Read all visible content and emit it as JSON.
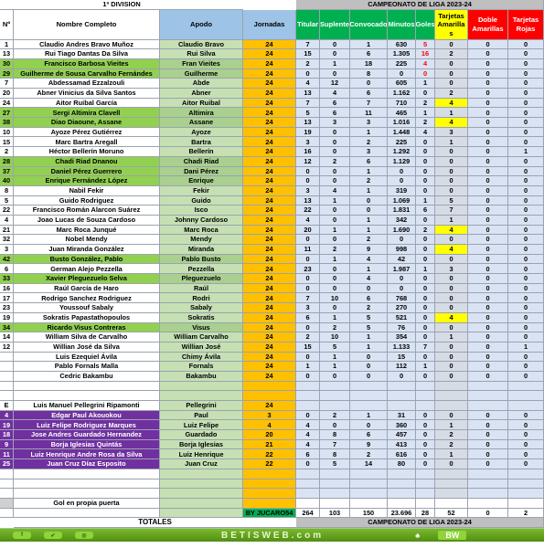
{
  "title": "1ª DIVISION",
  "competition": "CAMPEONATO  DE LIGA 2023-24",
  "headers": {
    "num": "Nº",
    "name": "Nombre Completo",
    "apodo": "Apodo",
    "jornadas": "Jornadas",
    "titular": "Titular",
    "suplente": "Suplente",
    "convocado": "Convocado",
    "minutos": "Minutos",
    "goles": "Goles",
    "amarillas": "Tarjetas Amarilla s",
    "doble": "Doble Amarillas",
    "rojas": "Tarjetas Rojas"
  },
  "colors": {
    "green": "#92d050",
    "purple": "#7030a0",
    "apodo": "#c6e0b4",
    "jornadas": "#ffc000",
    "stats": "#dae3f3",
    "yellow": "#ffff00",
    "red": "#ff0000",
    "stats_header": "#00b050"
  },
  "players": [
    {
      "num": "1",
      "name": "Claudio Andres Bravo Muñoz",
      "apodo": "Claudio Bravo",
      "jornadas": "24",
      "stats": [
        "7",
        "0",
        "1",
        "630",
        "5",
        "0",
        "0",
        "0"
      ],
      "goles_red": true
    },
    {
      "num": "13",
      "name": "Rui Tiago Dantas Da Silva",
      "apodo": "Rui Silva",
      "jornadas": "24",
      "stats": [
        "15",
        "0",
        "6",
        "1.305",
        "16",
        "2",
        "0",
        "0"
      ],
      "goles_red": true
    },
    {
      "num": "30",
      "name": "Francisco Barbosa Vieites",
      "apodo": "Fran Vieites",
      "jornadas": "24",
      "stats": [
        "2",
        "1",
        "18",
        "225",
        "4",
        "0",
        "0",
        "0"
      ],
      "goles_red": true,
      "style": "green"
    },
    {
      "num": "29",
      "name": "Guilherme de Sousa Carvalho Fernándes",
      "apodo": "Guilherme",
      "jornadas": "24",
      "stats": [
        "0",
        "0",
        "8",
        "0",
        "0",
        "0",
        "0",
        "0"
      ],
      "goles_red": true,
      "style": "green"
    },
    {
      "num": "7",
      "name": "Abdessamad Ezzalzouli",
      "apodo": "Abde",
      "jornadas": "24",
      "stats": [
        "4",
        "12",
        "0",
        "605",
        "1",
        "0",
        "0",
        "0"
      ]
    },
    {
      "num": "20",
      "name": "Abner Vinicius da Silva Santos",
      "apodo": "Abner",
      "jornadas": "24",
      "stats": [
        "13",
        "4",
        "6",
        "1.162",
        "0",
        "2",
        "0",
        "0"
      ]
    },
    {
      "num": "24",
      "name": "Aitor Ruibal García",
      "apodo": "Aitor Ruibal",
      "jornadas": "24",
      "stats": [
        "7",
        "6",
        "7",
        "710",
        "2",
        "4",
        "0",
        "0"
      ],
      "ama_yellow": true
    },
    {
      "num": "27",
      "name": "Sergi Altimira Clavell",
      "apodo": "Altimira",
      "jornadas": "24",
      "stats": [
        "5",
        "6",
        "11",
        "465",
        "1",
        "1",
        "0",
        "0"
      ],
      "style": "green"
    },
    {
      "num": "38",
      "name": "Diao Diaoune, Assane",
      "apodo": "Assane",
      "jornadas": "24",
      "stats": [
        "13",
        "3",
        "3",
        "1.016",
        "2",
        "4",
        "0",
        "0"
      ],
      "style": "green",
      "ama_yellow": true
    },
    {
      "num": "10",
      "name": "Ayoze Pérez Gutiérrez",
      "apodo": "Ayoze",
      "jornadas": "24",
      "stats": [
        "19",
        "0",
        "1",
        "1.448",
        "4",
        "3",
        "0",
        "0"
      ]
    },
    {
      "num": "15",
      "name": "Marc Bartra Aregall",
      "apodo": "Bartra",
      "jornadas": "24",
      "stats": [
        "3",
        "0",
        "2",
        "225",
        "0",
        "1",
        "0",
        "0"
      ]
    },
    {
      "num": "2",
      "name": "Héctor Bellerín Moruno",
      "apodo": "Bellerín",
      "jornadas": "24",
      "stats": [
        "16",
        "0",
        "3",
        "1.292",
        "0",
        "0",
        "0",
        "1"
      ]
    },
    {
      "num": "28",
      "name": "Chadi Riad Dnanou",
      "apodo": "Chadi Riad",
      "jornadas": "24",
      "stats": [
        "12",
        "2",
        "6",
        "1.129",
        "0",
        "0",
        "0",
        "0"
      ],
      "style": "green"
    },
    {
      "num": "37",
      "name": "Daniel Pérez Guerrero",
      "apodo": "Dani Pérez",
      "jornadas": "24",
      "stats": [
        "0",
        "0",
        "1",
        "0",
        "0",
        "0",
        "0",
        "0"
      ],
      "style": "green"
    },
    {
      "num": "40",
      "name": "Enrique Fernández López",
      "apodo": "Enrique",
      "jornadas": "24",
      "stats": [
        "0",
        "0",
        "2",
        "0",
        "0",
        "0",
        "0",
        "0"
      ],
      "style": "green"
    },
    {
      "num": "8",
      "name": "Nabil Fekir",
      "apodo": "Fekir",
      "jornadas": "24",
      "stats": [
        "3",
        "4",
        "1",
        "319",
        "0",
        "0",
        "0",
        "0"
      ]
    },
    {
      "num": "5",
      "name": "Guido Rodriguez",
      "apodo": "Guido",
      "jornadas": "24",
      "stats": [
        "13",
        "1",
        "0",
        "1.069",
        "1",
        "5",
        "0",
        "0"
      ]
    },
    {
      "num": "22",
      "name": "Francisco Román Alarcon Suárez",
      "apodo": "Isco",
      "jornadas": "24",
      "stats": [
        "22",
        "0",
        "0",
        "1.831",
        "6",
        "7",
        "0",
        "0"
      ]
    },
    {
      "num": "4",
      "name": "Joao Lucas de Souza Cardoso",
      "apodo": "Johnny Cardoso",
      "jornadas": "24",
      "stats": [
        "4",
        "0",
        "1",
        "342",
        "0",
        "1",
        "0",
        "0"
      ]
    },
    {
      "num": "21",
      "name": "Marc Roca Junqué",
      "apodo": "Marc Roca",
      "jornadas": "24",
      "stats": [
        "20",
        "1",
        "1",
        "1.690",
        "2",
        "4",
        "0",
        "0"
      ],
      "ama_yellow": true
    },
    {
      "num": "32",
      "name": "Nobel Mendy",
      "apodo": "Mendy",
      "jornadas": "24",
      "stats": [
        "0",
        "0",
        "2",
        "0",
        "0",
        "0",
        "0",
        "0"
      ]
    },
    {
      "num": "3",
      "name": "Juan Miranda González",
      "apodo": "Miranda",
      "jornadas": "24",
      "stats": [
        "11",
        "2",
        "9",
        "998",
        "0",
        "4",
        "0",
        "0"
      ],
      "ama_yellow": true
    },
    {
      "num": "42",
      "name": "Busto González, Pablo",
      "apodo": "Pablo Busto",
      "jornadas": "24",
      "stats": [
        "0",
        "1",
        "4",
        "42",
        "0",
        "0",
        "0",
        "0"
      ],
      "style": "green"
    },
    {
      "num": "6",
      "name": "German Alejo Pezzella",
      "apodo": "Pezzella",
      "jornadas": "24",
      "stats": [
        "23",
        "0",
        "1",
        "1.987",
        "1",
        "3",
        "0",
        "0"
      ]
    },
    {
      "num": "33",
      "name": "Xavier Pleguezuelo Selva",
      "apodo": "Pleguezuelo",
      "jornadas": "24",
      "stats": [
        "0",
        "0",
        "4",
        "0",
        "0",
        "0",
        "0",
        "0"
      ],
      "style": "green"
    },
    {
      "num": "16",
      "name": "Raúl García de Haro",
      "apodo": "Raúl",
      "jornadas": "24",
      "stats": [
        "0",
        "0",
        "0",
        "0",
        "0",
        "0",
        "0",
        "0"
      ]
    },
    {
      "num": "17",
      "name": "Rodrigo Sanchez Rodriguez",
      "apodo": "Rodri",
      "jornadas": "24",
      "stats": [
        "7",
        "10",
        "6",
        "768",
        "0",
        "0",
        "0",
        "0"
      ]
    },
    {
      "num": "23",
      "name": "Youssouf Sabaly",
      "apodo": "Sabaly",
      "jornadas": "24",
      "stats": [
        "3",
        "0",
        "2",
        "270",
        "0",
        "0",
        "0",
        "0"
      ]
    },
    {
      "num": "19",
      "name": "Sokratis Papastathopoulos",
      "apodo": "Sokratis",
      "jornadas": "24",
      "stats": [
        "6",
        "1",
        "5",
        "521",
        "0",
        "4",
        "0",
        "0"
      ],
      "ama_yellow": true
    },
    {
      "num": "34",
      "name": "Ricardo Visus Contreras",
      "apodo": "Visus",
      "jornadas": "24",
      "stats": [
        "0",
        "2",
        "5",
        "76",
        "0",
        "0",
        "0",
        "0"
      ],
      "style": "green"
    },
    {
      "num": "14",
      "name": "William Silva de Carvalho",
      "apodo": "William Carvalho",
      "jornadas": "24",
      "stats": [
        "2",
        "10",
        "1",
        "354",
        "0",
        "1",
        "0",
        "0"
      ]
    },
    {
      "num": "12",
      "name": "Willian José da Silva",
      "apodo": "Willian José",
      "jornadas": "24",
      "stats": [
        "15",
        "5",
        "1",
        "1.133",
        "7",
        "0",
        "0",
        "1"
      ]
    },
    {
      "num": "",
      "name": "Luis Ezequiel Ávila",
      "apodo": "Chimy Ávila",
      "jornadas": "24",
      "stats": [
        "0",
        "1",
        "0",
        "15",
        "0",
        "0",
        "0",
        "0"
      ]
    },
    {
      "num": "",
      "name": "Pablo Fornals Malla",
      "apodo": "Fornals",
      "jornadas": "24",
      "stats": [
        "1",
        "1",
        "0",
        "112",
        "1",
        "0",
        "0",
        "0"
      ]
    },
    {
      "num": "",
      "name": "Cedric Bakambu",
      "apodo": "Bakambu",
      "jornadas": "24",
      "stats": [
        "0",
        "0",
        "0",
        "0",
        "0",
        "0",
        "0",
        "0"
      ]
    },
    {
      "num": "",
      "name": "",
      "apodo": "",
      "jornadas": "",
      "stats": [
        "",
        "",
        "",
        "",
        "",
        "",
        "",
        ""
      ]
    },
    {
      "num": "",
      "name": "",
      "apodo": "",
      "jornadas": "",
      "stats": [
        "",
        "",
        "",
        "",
        "",
        "",
        "",
        ""
      ]
    },
    {
      "num": "E",
      "name": "Luis Manuel Pellegrini Ripamonti",
      "apodo": "Pellegrini",
      "jornadas": "24",
      "stats": [
        "",
        "",
        "",
        "",
        "",
        "",
        "",
        ""
      ]
    },
    {
      "num": "4",
      "name": "Edgar Paul Akouokou",
      "apodo": "Paul",
      "jornadas": "3",
      "stats": [
        "0",
        "2",
        "1",
        "31",
        "0",
        "0",
        "0",
        "0"
      ],
      "style": "purple"
    },
    {
      "num": "19",
      "name": "Luiz Felipe Rodriguez Marques",
      "apodo": "Luiz Felipe",
      "jornadas": "4",
      "stats": [
        "4",
        "0",
        "0",
        "360",
        "0",
        "1",
        "0",
        "0"
      ],
      "style": "purple"
    },
    {
      "num": "18",
      "name": "Jose Andres Guardado Hernandez",
      "apodo": "Guardado",
      "jornadas": "20",
      "stats": [
        "4",
        "8",
        "6",
        "457",
        "0",
        "2",
        "0",
        "0"
      ],
      "style": "purple"
    },
    {
      "num": "9",
      "name": "Borja Iglesias Quintás",
      "apodo": "Borja Iglesias",
      "jornadas": "21",
      "stats": [
        "4",
        "7",
        "9",
        "413",
        "0",
        "2",
        "0",
        "0"
      ],
      "style": "purple"
    },
    {
      "num": "11",
      "name": "Luiz Henrique Andre Rosa da Silva",
      "apodo": "Luiz Henrique",
      "jornadas": "22",
      "stats": [
        "6",
        "8",
        "2",
        "616",
        "0",
        "1",
        "0",
        "0"
      ],
      "style": "purple"
    },
    {
      "num": "25",
      "name": "Juan Cruz Díaz Esposito",
      "apodo": "Juan Cruz",
      "jornadas": "22",
      "stats": [
        "0",
        "5",
        "14",
        "80",
        "0",
        "0",
        "0",
        "0"
      ],
      "style": "purple"
    },
    {
      "num": "",
      "name": "",
      "apodo": "",
      "jornadas": "",
      "stats": [
        "",
        "",
        "",
        "",
        "",
        "",
        "",
        ""
      ]
    },
    {
      "num": "",
      "name": "",
      "apodo": "",
      "jornadas": "",
      "stats": [
        "",
        "",
        "",
        "",
        "",
        "",
        "",
        ""
      ]
    },
    {
      "num": "",
      "name": "",
      "apodo": "",
      "jornadas": "",
      "stats": [
        "",
        "",
        "",
        "",
        "",
        "",
        "",
        ""
      ]
    },
    {
      "num": "",
      "name": "Gol en propia puerta",
      "apodo": "",
      "jornadas": "",
      "stats": [
        "",
        "",
        "",
        "",
        "",
        "",
        "",
        ""
      ],
      "style": "own"
    }
  ],
  "totals": {
    "credit": "BY JUCARO54",
    "label": "TOTALES",
    "values": [
      "264",
      "103",
      "150",
      "23.696",
      "28",
      "52",
      "0",
      "2"
    ]
  },
  "footer": {
    "site": "BETISWEB.com",
    "logo": "BW",
    "social_icons": [
      "facebook-icon",
      "twitter-icon",
      "instagram-icon"
    ]
  }
}
